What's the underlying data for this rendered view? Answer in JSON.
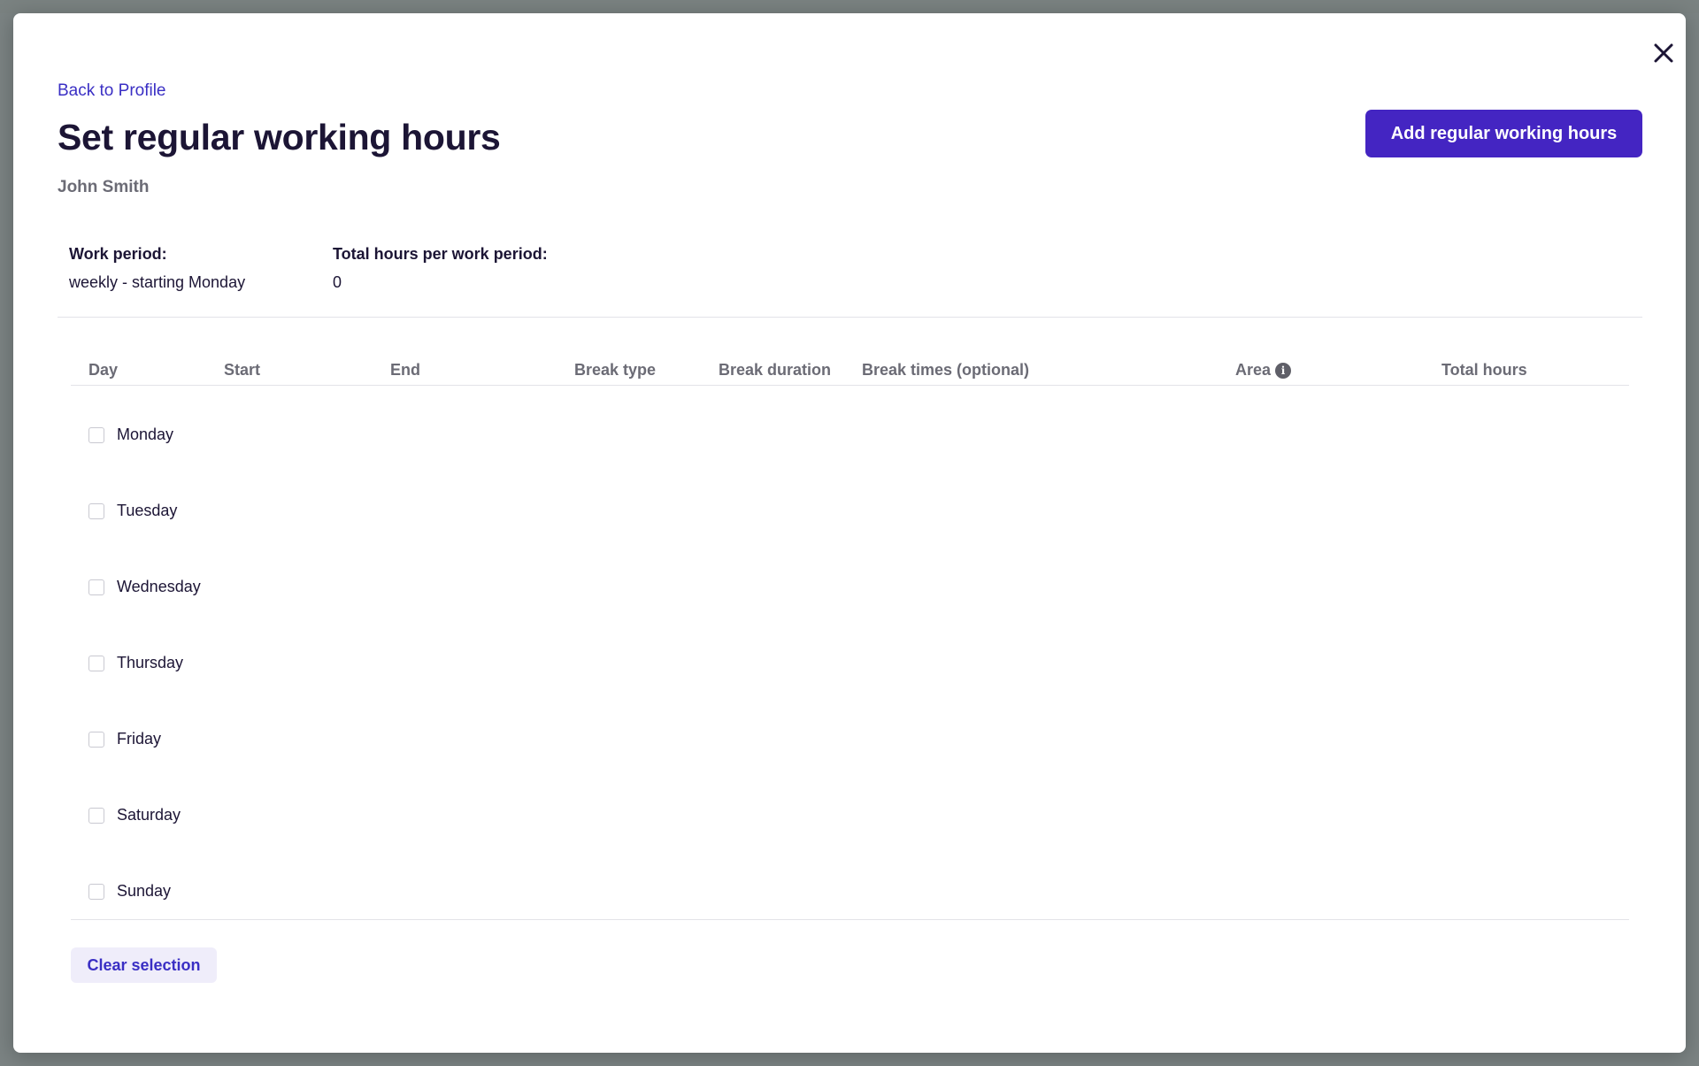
{
  "modal": {
    "back_link": "Back to Profile",
    "title": "Set regular working hours",
    "employee_name": "John Smith",
    "primary_action": "Add regular working hours",
    "close_icon": "close-icon"
  },
  "summary": {
    "work_period_label": "Work period:",
    "work_period_value": "weekly - starting Monday",
    "total_hours_label": "Total hours per work period:",
    "total_hours_value": "0"
  },
  "table": {
    "columns": {
      "day": "Day",
      "start": "Start",
      "end": "End",
      "break_type": "Break type",
      "break_duration": "Break duration",
      "break_times": "Break times (optional)",
      "area": "Area",
      "total_hours": "Total hours"
    },
    "area_info_icon": "info-icon",
    "days": [
      {
        "label": "Monday",
        "checked": false
      },
      {
        "label": "Tuesday",
        "checked": false
      },
      {
        "label": "Wednesday",
        "checked": false
      },
      {
        "label": "Thursday",
        "checked": false
      },
      {
        "label": "Friday",
        "checked": false
      },
      {
        "label": "Saturday",
        "checked": false
      },
      {
        "label": "Sunday",
        "checked": false
      }
    ]
  },
  "footer": {
    "clear_selection": "Clear selection"
  },
  "colors": {
    "primary": "#4425c2",
    "link": "#3a2fc4",
    "heading": "#1c1535",
    "muted": "#6b6b75",
    "backdrop": "#7b8383"
  }
}
